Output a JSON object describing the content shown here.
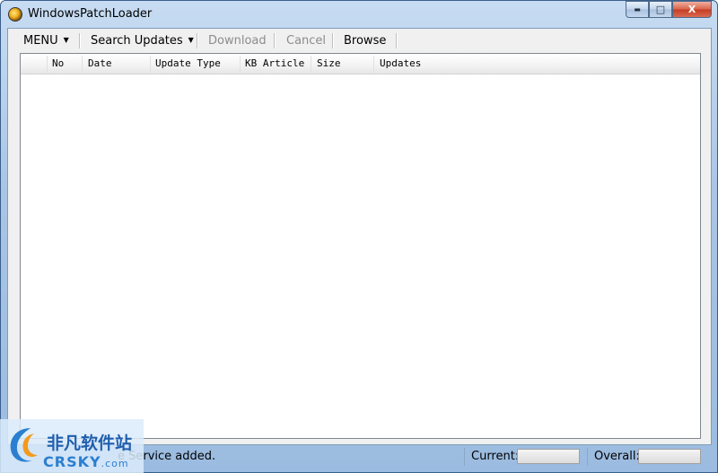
{
  "window": {
    "title": "WindowsPatchLoader"
  },
  "controls": {
    "minimize": "▬",
    "maximize": "□",
    "close": "X"
  },
  "menu": {
    "menu_label": "MENU",
    "search_label": "Search Updates",
    "download_label": "Download",
    "cancel_label": "Cancel",
    "browse_label": "Browse"
  },
  "table": {
    "columns": [
      "No",
      "Date",
      "Update Type",
      "KB Article",
      "Size",
      "Updates"
    ]
  },
  "status": {
    "message": "e Service added.",
    "current_label": "Current:",
    "overall_label": "Overall:"
  },
  "watermark": {
    "cn": "非凡软件站",
    "en": "CRSKY",
    "com": ".com"
  }
}
